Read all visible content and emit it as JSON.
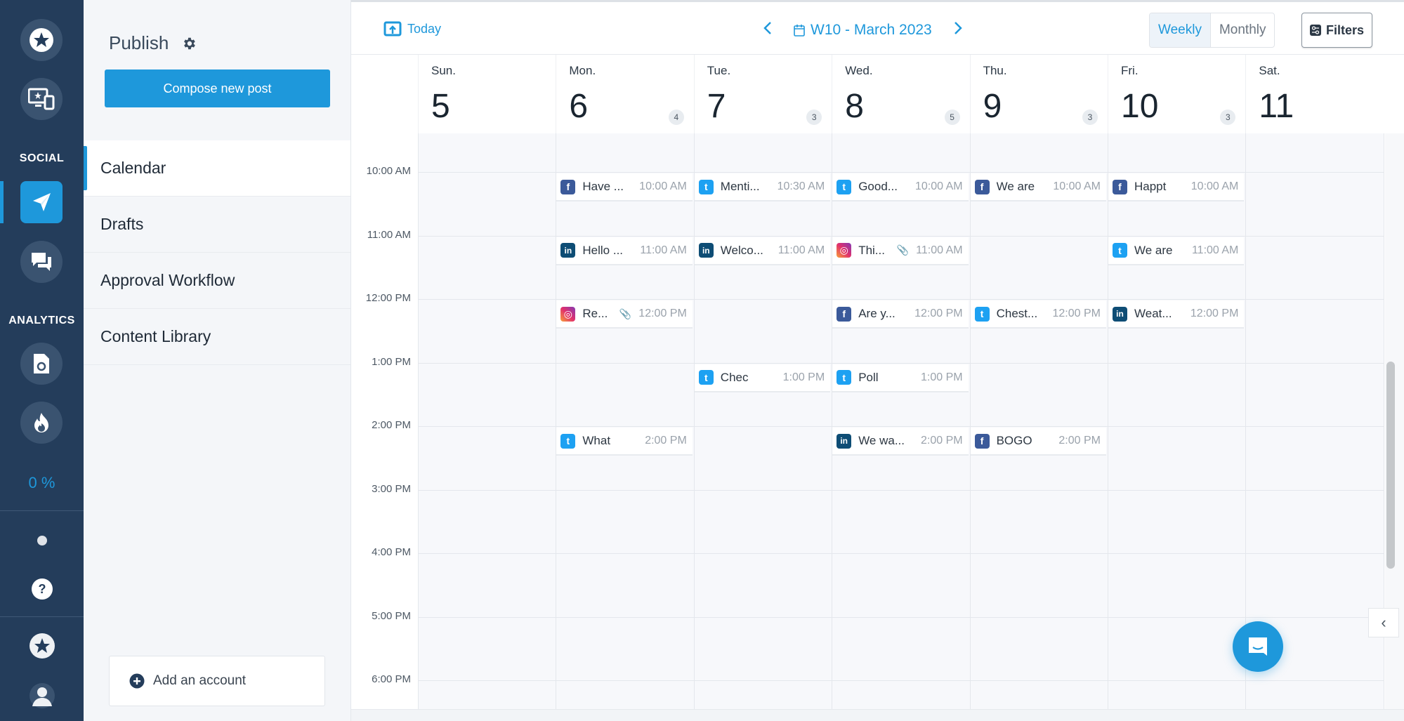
{
  "rail": {
    "section_social": "SOCIAL",
    "section_analytics": "ANALYTICS",
    "progress_text": "0 %",
    "icons": [
      "star-icon",
      "screen-devices-icon",
      "paper-plane-icon",
      "chat-bubbles-icon",
      "report-icon",
      "flame-icon",
      "dot-icon",
      "help-icon",
      "star-badge-icon",
      "user-avatar-icon"
    ],
    "accent": "#1e98db"
  },
  "panel": {
    "title": "Publish",
    "compose_label": "Compose new post",
    "nav": [
      {
        "label": "Calendar",
        "active": true
      },
      {
        "label": "Drafts",
        "active": false
      },
      {
        "label": "Approval Workflow",
        "active": false
      },
      {
        "label": "Content Library",
        "active": false
      }
    ],
    "add_account_label": "Add an account"
  },
  "toolbar": {
    "today_label": "Today",
    "week_label": "W10 - March 2023",
    "view_options": [
      {
        "label": "Weekly",
        "selected": true
      },
      {
        "label": "Monthly",
        "selected": false
      }
    ],
    "filters_label": "Filters"
  },
  "days": [
    {
      "name": "Sun.",
      "date": "5",
      "count": null
    },
    {
      "name": "Mon.",
      "date": "6",
      "count": "4"
    },
    {
      "name": "Tue.",
      "date": "7",
      "count": "3"
    },
    {
      "name": "Wed.",
      "date": "8",
      "count": "5"
    },
    {
      "name": "Thu.",
      "date": "9",
      "count": "3"
    },
    {
      "name": "Fri.",
      "date": "10",
      "count": "3"
    },
    {
      "name": "Sat.",
      "date": "11",
      "count": null
    }
  ],
  "time_labels": [
    "10:00 AM",
    "11:00 AM",
    "12:00 PM",
    "1:00 PM",
    "2:00 PM",
    "3:00 PM",
    "4:00 PM",
    "5:00 PM",
    "6:00 PM"
  ],
  "events": [
    {
      "day": 1,
      "slot": 0,
      "network": "facebook",
      "title": "Have ...",
      "time": "10:00 AM",
      "attachment": false
    },
    {
      "day": 2,
      "slot": 0,
      "network": "twitter",
      "title": "Menti...",
      "time": "10:30 AM",
      "attachment": false
    },
    {
      "day": 3,
      "slot": 0,
      "network": "twitter",
      "title": "Good...",
      "time": "10:00 AM",
      "attachment": false
    },
    {
      "day": 4,
      "slot": 0,
      "network": "facebook",
      "title": "We are",
      "time": "10:00 AM",
      "attachment": false
    },
    {
      "day": 5,
      "slot": 0,
      "network": "facebook",
      "title": "Happt",
      "time": "10:00 AM",
      "attachment": false
    },
    {
      "day": 1,
      "slot": 1,
      "network": "linkedin",
      "title": "Hello ...",
      "time": "11:00 AM",
      "attachment": false
    },
    {
      "day": 2,
      "slot": 1,
      "network": "linkedin",
      "title": "Welco...",
      "time": "11:00 AM",
      "attachment": false
    },
    {
      "day": 3,
      "slot": 1,
      "network": "instagram",
      "title": "Thi...",
      "time": "11:00 AM",
      "attachment": true
    },
    {
      "day": 5,
      "slot": 1,
      "network": "twitter",
      "title": "We are",
      "time": "11:00 AM",
      "attachment": false
    },
    {
      "day": 1,
      "slot": 2,
      "network": "instagram",
      "title": "Re...",
      "time": "12:00 PM",
      "attachment": true
    },
    {
      "day": 3,
      "slot": 2,
      "network": "facebook",
      "title": "Are y...",
      "time": "12:00 PM",
      "attachment": false
    },
    {
      "day": 4,
      "slot": 2,
      "network": "twitter",
      "title": "Chest...",
      "time": "12:00 PM",
      "attachment": false
    },
    {
      "day": 5,
      "slot": 2,
      "network": "linkedin",
      "title": "Weat...",
      "time": "12:00 PM",
      "attachment": false
    },
    {
      "day": 2,
      "slot": 3,
      "network": "twitter",
      "title": "Chec",
      "time": "1:00 PM",
      "attachment": false
    },
    {
      "day": 3,
      "slot": 3,
      "network": "twitter",
      "title": "Poll",
      "time": "1:00 PM",
      "attachment": false
    },
    {
      "day": 1,
      "slot": 4,
      "network": "twitter",
      "title": "What",
      "time": "2:00 PM",
      "attachment": false
    },
    {
      "day": 3,
      "slot": 4,
      "network": "linkedin",
      "title": "We wa...",
      "time": "2:00 PM",
      "attachment": false
    },
    {
      "day": 4,
      "slot": 4,
      "network": "facebook",
      "title": "BOGO",
      "time": "2:00 PM",
      "attachment": false
    }
  ],
  "network_glyphs": {
    "facebook": "f",
    "twitter": "t",
    "linkedin": "in",
    "instagram": "◎"
  },
  "collapse_glyph": "‹"
}
